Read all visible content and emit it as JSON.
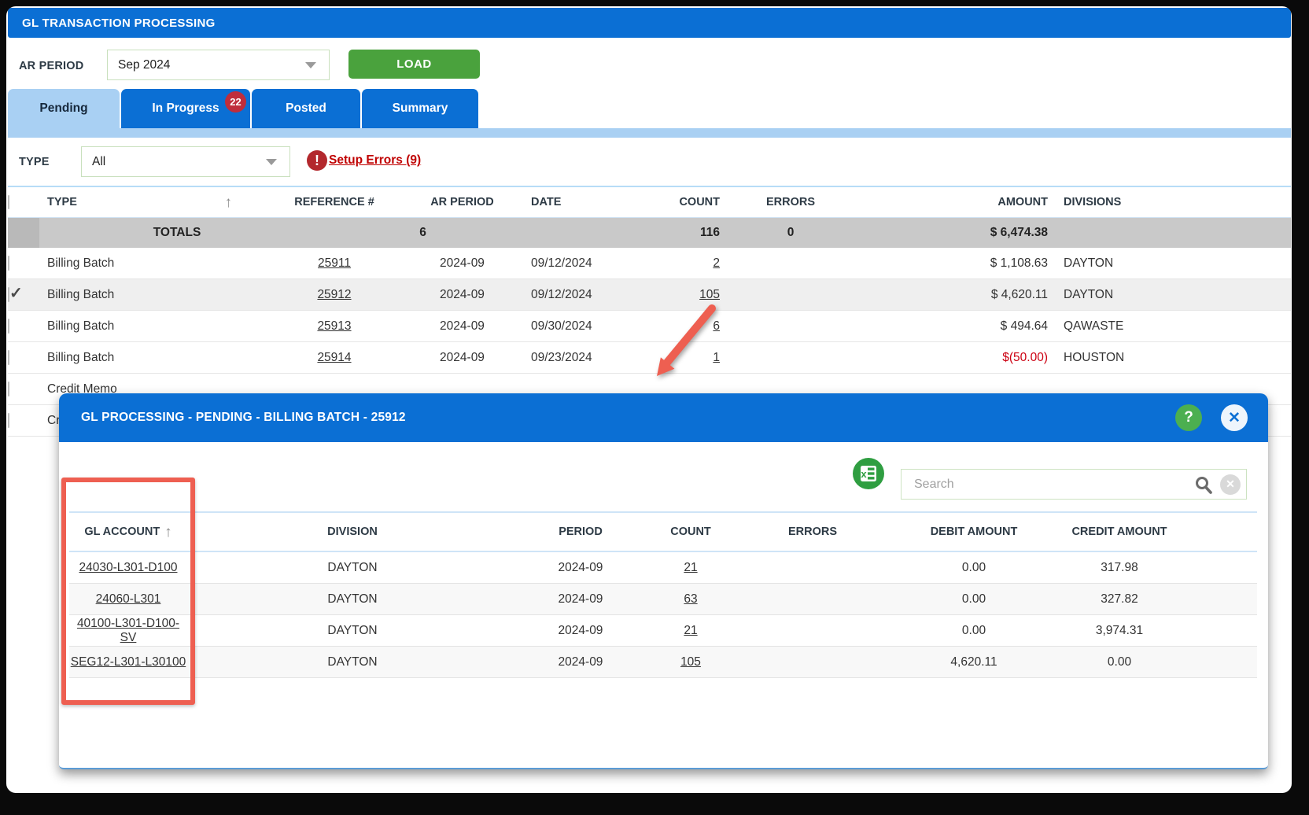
{
  "window": {
    "title": "GL TRANSACTION PROCESSING"
  },
  "toolbar": {
    "ar_period_label": "AR PERIOD",
    "ar_period_value": "Sep 2024",
    "load_label": "LOAD"
  },
  "tabs": {
    "pending": "Pending",
    "in_progress": "In Progress",
    "in_progress_badge": "22",
    "posted": "Posted",
    "summary": "Summary"
  },
  "filters": {
    "type_label": "TYPE",
    "type_value": "All",
    "setup_errors_label": "Setup Errors (9)"
  },
  "main_table": {
    "columns": {
      "type": "TYPE",
      "reference": "REFERENCE #",
      "ar_period": "AR PERIOD",
      "date": "DATE",
      "count": "COUNT",
      "errors": "ERRORS",
      "amount": "AMOUNT",
      "divisions": "DIVISIONS"
    },
    "totals": {
      "label": "TOTALS",
      "reference_total": "6",
      "count": "116",
      "errors": "0",
      "amount": "$ 6,474.38"
    },
    "rows": [
      {
        "type": "Billing Batch",
        "reference": "25911",
        "ar_period": "2024-09",
        "date": "09/12/2024",
        "count": "2",
        "errors": "",
        "amount": "$ 1,108.63",
        "division": "DAYTON",
        "checked": false,
        "selected": false
      },
      {
        "type": "Billing Batch",
        "reference": "25912",
        "ar_period": "2024-09",
        "date": "09/12/2024",
        "count": "105",
        "errors": "",
        "amount": "$ 4,620.11",
        "division": "DAYTON",
        "checked": true,
        "selected": true,
        "amount_negative": false
      },
      {
        "type": "Billing Batch",
        "reference": "25913",
        "ar_period": "2024-09",
        "date": "09/30/2024",
        "count": "6",
        "errors": "",
        "amount": "$ 494.64",
        "division": "QAWASTE",
        "checked": false,
        "selected": false
      },
      {
        "type": "Billing Batch",
        "reference": "25914",
        "ar_period": "2024-09",
        "date": "09/23/2024",
        "count": "1",
        "errors": "",
        "amount": "$(50.00)",
        "division": "HOUSTON",
        "checked": false,
        "selected": false,
        "amount_negative": true
      },
      {
        "type": "Credit Memo",
        "reference": "",
        "ar_period": "",
        "date": "",
        "count": "",
        "errors": "",
        "amount": "",
        "division": "",
        "checked": false,
        "selected": false
      },
      {
        "type": "Credit Memo",
        "reference": "",
        "ar_period": "",
        "date": "",
        "count": "",
        "errors": "",
        "amount": "",
        "division": "",
        "checked": false,
        "selected": false
      }
    ]
  },
  "modal": {
    "title": "GL PROCESSING - PENDING - BILLING BATCH - 25912",
    "search_placeholder": "Search",
    "table": {
      "columns": {
        "gl_account": "GL ACCOUNT",
        "division": "DIVISION",
        "period": "PERIOD",
        "count": "COUNT",
        "errors": "ERRORS",
        "debit": "DEBIT AMOUNT",
        "credit": "CREDIT AMOUNT"
      },
      "rows": [
        {
          "gl_account": "24030-L301-D100",
          "division": "DAYTON",
          "period": "2024-09",
          "count": "21",
          "errors": "",
          "debit": "0.00",
          "credit": "317.98"
        },
        {
          "gl_account": "24060-L301",
          "division": "DAYTON",
          "period": "2024-09",
          "count": "63",
          "errors": "",
          "debit": "0.00",
          "credit": "327.82"
        },
        {
          "gl_account": "40100-L301-D100-SV",
          "division": "DAYTON",
          "period": "2024-09",
          "count": "21",
          "errors": "",
          "debit": "0.00",
          "credit": "3,974.31"
        },
        {
          "gl_account": "SEG12-L301-L30100",
          "division": "DAYTON",
          "period": "2024-09",
          "count": "105",
          "errors": "",
          "debit": "4,620.11",
          "credit": "0.00"
        }
      ]
    }
  },
  "icons": {
    "sort_up": "↑",
    "checkmark": "✓",
    "error_exclaim": "!",
    "help_question": "?",
    "close_x": "✕",
    "clear_x": "✕"
  },
  "colors": {
    "accent_blue": "#0b6fd4",
    "tab_light_blue": "#a9d0f3",
    "button_green": "#4aa23d",
    "error_red": "#c00000",
    "negative_red": "#cc0011",
    "totals_gray": "#c9c9c9",
    "annotation_red": "#ee5f51"
  }
}
